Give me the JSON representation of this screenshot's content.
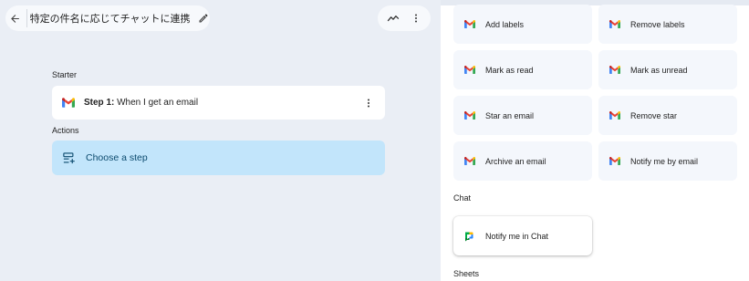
{
  "header": {
    "title": "特定の件名に応じてチャットに連携",
    "back_icon": "arrow-left-icon",
    "edit_icon": "pencil-icon",
    "activity_icon": "activity-icon",
    "more_icon": "more-vert-icon"
  },
  "flow": {
    "starter_label": "Starter",
    "step1_prefix": "Step 1:",
    "step1_text": " When I get an email",
    "actions_label": "Actions",
    "choose_step": "Choose a step"
  },
  "picker": {
    "gmail_actions": [
      "Add labels",
      "Remove labels",
      "Mark as read",
      "Mark as unread",
      "Star an email",
      "Remove star",
      "Archive an email",
      "Notify me by email"
    ],
    "chat_label": "Chat",
    "chat_actions": [
      "Notify me in Chat"
    ],
    "sheets_label": "Sheets"
  },
  "colors": {
    "left_bg": "#eaeef5",
    "choose_bg": "#c2e5fb",
    "tile_bg": "#f4f7fc"
  }
}
